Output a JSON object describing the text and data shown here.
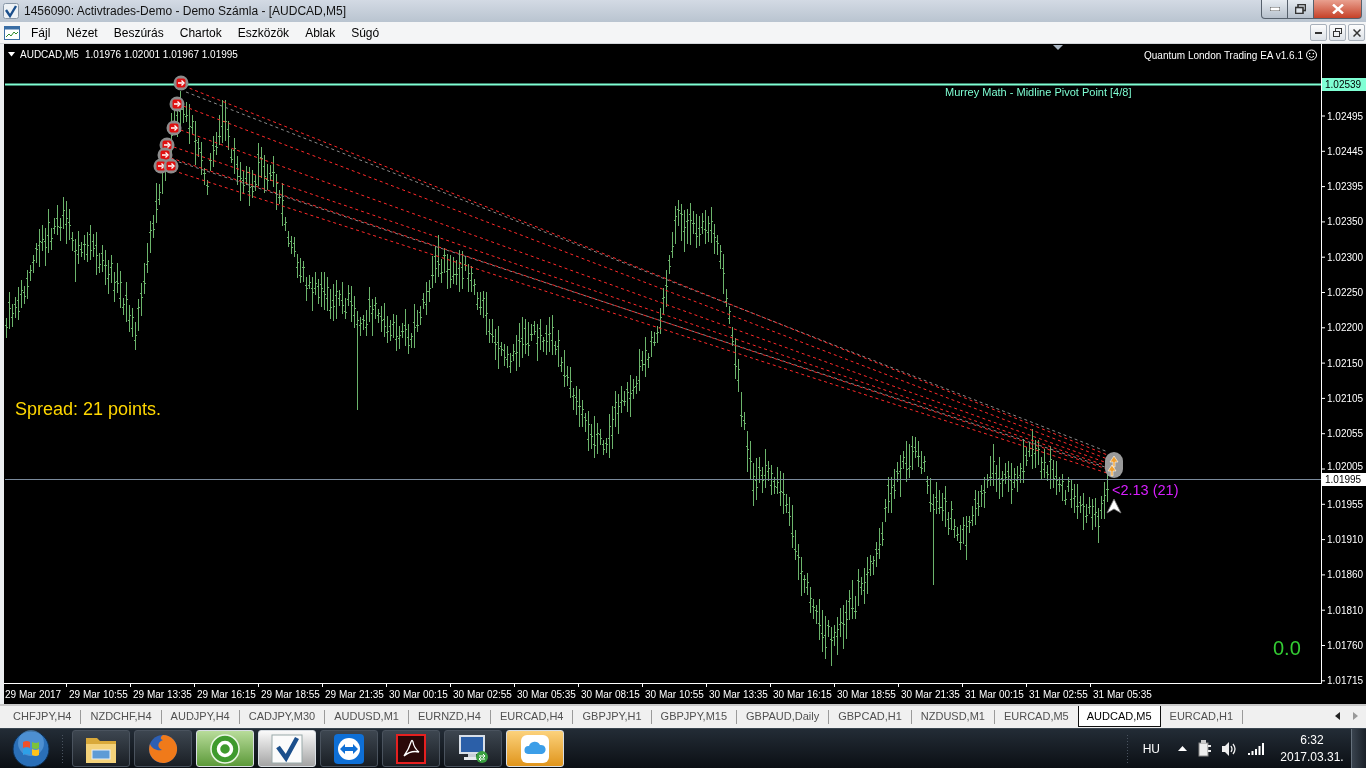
{
  "window": {
    "title": "1456090: Activtrades-Demo - Demo Számla - [AUDCAD,M5]"
  },
  "menu": [
    "Fájl",
    "Nézet",
    "Beszúrás",
    "Chartok",
    "Eszközök",
    "Ablak",
    "Súgó"
  ],
  "chart": {
    "symbol": "AUDCAD,M5",
    "quotes": "1.01976 1.02001 1.01967 1.01995",
    "expert": "Quantum London Trading EA v1.6.1",
    "pivot_label": "Murrey Math - Midline Pivot Point [4/8]",
    "spread": "Spread: 21 points.",
    "profit": "0.0",
    "trade_label": "<2.13 (21)",
    "price_tags": [
      {
        "kind": "pivot",
        "text": "1.02539"
      },
      {
        "kind": "bid",
        "text": "1.01995"
      }
    ],
    "price_axis": [
      "1.02495",
      "1.02445",
      "1.02395",
      "1.02350",
      "1.02300",
      "1.02250",
      "1.02200",
      "1.02150",
      "1.02105",
      "1.02055",
      "1.02005",
      "1.01955",
      "1.01910",
      "1.01860",
      "1.01810",
      "1.01760",
      "1.01715"
    ],
    "time_axis": [
      "29 Mar 2017",
      "29 Mar 10:55",
      "29 Mar 13:35",
      "29 Mar 16:15",
      "29 Mar 18:55",
      "29 Mar 21:35",
      "30 Mar 00:15",
      "30 Mar 02:55",
      "30 Mar 05:35",
      "30 Mar 08:15",
      "30 Mar 10:55",
      "30 Mar 13:35",
      "30 Mar 16:15",
      "30 Mar 18:55",
      "30 Mar 21:35",
      "31 Mar 00:15",
      "31 Mar 02:55",
      "31 Mar 05:35"
    ]
  },
  "tabs": [
    {
      "label": "CHFJPY,H4",
      "selected": false
    },
    {
      "label": "NZDCHF,H4",
      "selected": false
    },
    {
      "label": "AUDJPY,H4",
      "selected": false
    },
    {
      "label": "CADJPY,M30",
      "selected": false
    },
    {
      "label": "AUDUSD,M1",
      "selected": false
    },
    {
      "label": "EURNZD,H4",
      "selected": false
    },
    {
      "label": "EURCAD,H4",
      "selected": false
    },
    {
      "label": "GBPJPY,H1",
      "selected": false
    },
    {
      "label": "GBPJPY,M15",
      "selected": false
    },
    {
      "label": "GBPAUD,Daily",
      "selected": false
    },
    {
      "label": "GBPCAD,H1",
      "selected": false
    },
    {
      "label": "NZDUSD,M1",
      "selected": false
    },
    {
      "label": "EURCAD,M5",
      "selected": false
    },
    {
      "label": "AUDCAD,M5",
      "selected": true
    },
    {
      "label": "EURCAD,H1",
      "selected": false
    }
  ],
  "taskbar": {
    "apps": [
      {
        "kind": "explorer",
        "highlighted": false
      },
      {
        "kind": "firefox",
        "highlighted": false
      },
      {
        "kind": "utorrent",
        "highlighted": true
      },
      {
        "kind": "metatrader",
        "highlighted": true
      },
      {
        "kind": "teamviewer",
        "highlighted": false
      },
      {
        "kind": "acrobat",
        "highlighted": false
      },
      {
        "kind": "rdp",
        "highlighted": false
      },
      {
        "kind": "icloud",
        "highlighted": true
      }
    ],
    "language": "HU",
    "time": "6:32",
    "date": "2017.03.31."
  }
}
